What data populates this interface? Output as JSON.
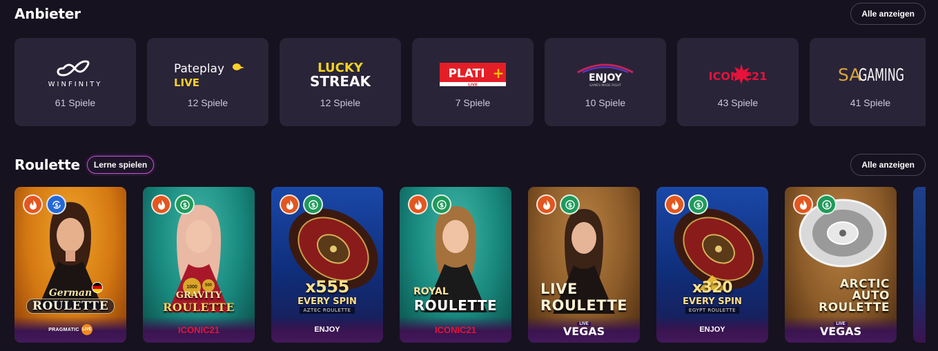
{
  "providers_section": {
    "title": "Anbieter",
    "show_all_label": "Alle anzeigen",
    "items": [
      {
        "name": "WINFINITY",
        "count": "61 Spiele"
      },
      {
        "name": "Pateplay",
        "sub": "LIVE",
        "count": "12 Spiele"
      },
      {
        "name": "LUCKY",
        "sub": "STREAK",
        "count": "12 Spiele"
      },
      {
        "name": "PLATI",
        "sub": "LIVE",
        "count": "7 Spiele"
      },
      {
        "name": "ENJOY",
        "sub": "GAMES MADE RIGHT",
        "count": "10 Spiele"
      },
      {
        "name": "ICONIC21",
        "count": "43 Spiele"
      },
      {
        "name": "SA",
        "sub": "GAMING",
        "count": "41 Spiele"
      }
    ]
  },
  "roulette_section": {
    "title": "Roulette",
    "learn_label": "Lerne spielen",
    "show_all_label": "Alle anzeigen",
    "games": [
      {
        "title_small": "German",
        "title_big": "ROULETTE",
        "provider": "PRAGMATIC",
        "provider_tag": "LIVE"
      },
      {
        "title_small": "GRAVITY",
        "title_big": "ROULETTE",
        "provider": "ICONIC21",
        "chip_a": "1000",
        "chip_b": "500"
      },
      {
        "title_gold": "x555",
        "title_sub": "EVERY SPIN",
        "title_tiny": "AZTEC ROULETTE",
        "provider": "ENJOY"
      },
      {
        "title_small": "ROYAL",
        "title_big": "ROULETTE",
        "provider": "ICONIC21"
      },
      {
        "title_small": "LIVE",
        "title_big": "ROULETTE",
        "provider": "VEGAS",
        "provider_tag": "LIVE"
      },
      {
        "title_gold": "x320",
        "title_sub": "EVERY SPIN",
        "title_tiny": "EGYPT ROULETTE",
        "provider": "ENJOY"
      },
      {
        "title_small": "ARCTIC",
        "title_mid": "AUTO",
        "title_big": "ROULETTE",
        "provider": "VEGAS",
        "provider_tag": "LIVE"
      }
    ]
  },
  "colors": {
    "background": "#16121f",
    "card": "#2a2438",
    "hot_badge": "#e2571f",
    "money_badge": "#1f9a5a",
    "accent_pill": "#c94fd8"
  },
  "icons": [
    "flame-icon",
    "dollar-icon",
    "rotate-dollar-icon"
  ]
}
